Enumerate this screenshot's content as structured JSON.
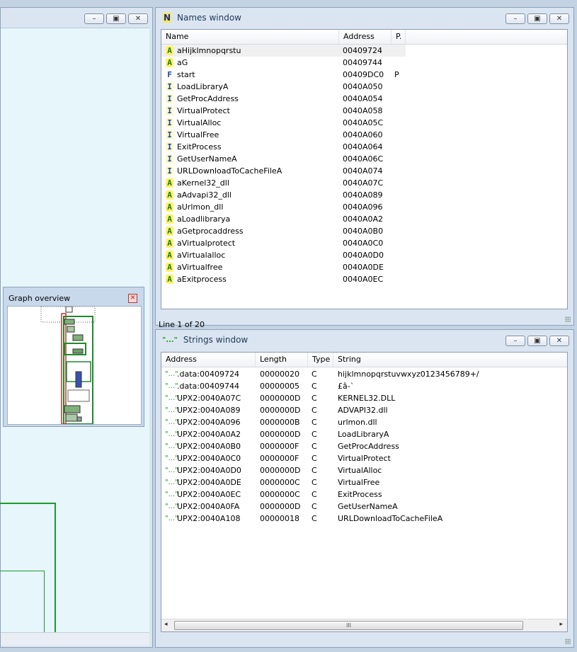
{
  "graph_overview": {
    "title": "Graph overview"
  },
  "names_window": {
    "title": "Names window",
    "icon_letter": "N",
    "columns": [
      "Name",
      "Address",
      "P."
    ],
    "rows": [
      {
        "type": "A",
        "name": "aHijklmnopqrstu",
        "address": "00409724",
        "p": ""
      },
      {
        "type": "A",
        "name": "aG",
        "address": "00409744",
        "p": ""
      },
      {
        "type": "F",
        "name": "start",
        "address": "00409DC0",
        "p": "P"
      },
      {
        "type": "I",
        "name": "LoadLibraryA",
        "address": "0040A050",
        "p": ""
      },
      {
        "type": "I",
        "name": "GetProcAddress",
        "address": "0040A054",
        "p": ""
      },
      {
        "type": "I",
        "name": "VirtualProtect",
        "address": "0040A058",
        "p": ""
      },
      {
        "type": "I",
        "name": "VirtualAlloc",
        "address": "0040A05C",
        "p": ""
      },
      {
        "type": "I",
        "name": "VirtualFree",
        "address": "0040A060",
        "p": ""
      },
      {
        "type": "I",
        "name": "ExitProcess",
        "address": "0040A064",
        "p": ""
      },
      {
        "type": "I",
        "name": "GetUserNameA",
        "address": "0040A06C",
        "p": ""
      },
      {
        "type": "I",
        "name": "URLDownloadToCacheFileA",
        "address": "0040A074",
        "p": ""
      },
      {
        "type": "A",
        "name": "aKernel32_dll",
        "address": "0040A07C",
        "p": ""
      },
      {
        "type": "A",
        "name": "aAdvapi32_dll",
        "address": "0040A089",
        "p": ""
      },
      {
        "type": "A",
        "name": "aUrlmon_dll",
        "address": "0040A096",
        "p": ""
      },
      {
        "type": "A",
        "name": "aLoadlibrarya",
        "address": "0040A0A2",
        "p": ""
      },
      {
        "type": "A",
        "name": "aGetprocaddress",
        "address": "0040A0B0",
        "p": ""
      },
      {
        "type": "A",
        "name": "aVirtualprotect",
        "address": "0040A0C0",
        "p": ""
      },
      {
        "type": "A",
        "name": "aVirtualalloc",
        "address": "0040A0D0",
        "p": ""
      },
      {
        "type": "A",
        "name": "aVirtualfree",
        "address": "0040A0DE",
        "p": ""
      },
      {
        "type": "A",
        "name": "aExitprocess",
        "address": "0040A0EC",
        "p": ""
      }
    ],
    "status": "Line 1 of 20"
  },
  "strings_window": {
    "title": "Strings window",
    "icon_text": "\"...\"",
    "columns": [
      "Address",
      "Length",
      "Type",
      "String"
    ],
    "rows": [
      {
        "address": ".data:00409724",
        "length": "00000020",
        "type": "C",
        "string": "hijklmnopqrstuvwxyz0123456789+/"
      },
      {
        "address": ".data:00409744",
        "length": "00000005",
        "type": "C",
        "string": "£â-`"
      },
      {
        "address": "UPX2:0040A07C",
        "length": "0000000D",
        "type": "C",
        "string": "KERNEL32.DLL"
      },
      {
        "address": "UPX2:0040A089",
        "length": "0000000D",
        "type": "C",
        "string": "ADVAPI32.dll"
      },
      {
        "address": "UPX2:0040A096",
        "length": "0000000B",
        "type": "C",
        "string": "urlmon.dll"
      },
      {
        "address": "UPX2:0040A0A2",
        "length": "0000000D",
        "type": "C",
        "string": "LoadLibraryA"
      },
      {
        "address": "UPX2:0040A0B0",
        "length": "0000000F",
        "type": "C",
        "string": "GetProcAddress"
      },
      {
        "address": "UPX2:0040A0C0",
        "length": "0000000F",
        "type": "C",
        "string": "VirtualProtect"
      },
      {
        "address": "UPX2:0040A0D0",
        "length": "0000000D",
        "type": "C",
        "string": "VirtualAlloc"
      },
      {
        "address": "UPX2:0040A0DE",
        "length": "0000000C",
        "type": "C",
        "string": "VirtualFree"
      },
      {
        "address": "UPX2:0040A0EC",
        "length": "0000000C",
        "type": "C",
        "string": "ExitProcess"
      },
      {
        "address": "UPX2:0040A0FA",
        "length": "0000000D",
        "type": "C",
        "string": "GetUserNameA"
      },
      {
        "address": "UPX2:0040A108",
        "length": "00000018",
        "type": "C",
        "string": "URLDownloadToCacheFileA"
      }
    ],
    "scrollbar_thumb": "III"
  },
  "window_buttons": {
    "minimize": "–",
    "restore": "▣",
    "close": "✕"
  },
  "colors": {
    "accent_green": "#1f9a2b",
    "names_icon_bg": "#f5e95a",
    "selected_row": "#f0f0f0"
  }
}
